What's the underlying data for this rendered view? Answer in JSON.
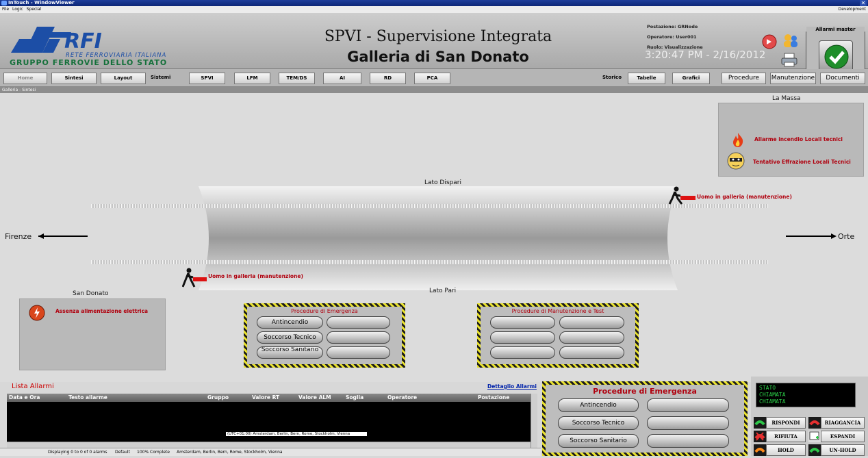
{
  "window": {
    "title": "InTouch - WindowViewer",
    "menus": [
      "File",
      "Logic",
      "Special"
    ],
    "right_label": "Development"
  },
  "header": {
    "brand_main": "RFI",
    "brand_sub": "RETE FERROVIARIA ITALIANA",
    "brand_group": "GRUPPO FERROVIE DELLO STATO",
    "title": "SPVI - Supervisione Integrata",
    "subtitle": "Galleria di San Donato",
    "postazione": "Postazione: GRNode",
    "operatore": "Operatore: User001",
    "ruolo": "Ruolo: Visualizzazione",
    "clock": "3:20:47 PM - 2/16/2012",
    "alarm_master_label": "Allarmi master"
  },
  "nav": {
    "home": "Home",
    "sintesi": "Sintesi",
    "layout": "Layout",
    "sistemi_label": "Sistemi",
    "sistemi": [
      "SPVI",
      "LFM",
      "TEM/DS",
      "AI",
      "RD",
      "PCA"
    ],
    "storico_label": "Storico",
    "tabelle": "Tabelle",
    "grafici": "Grafici",
    "procedure": "Procedure",
    "manutenzione": "Manutenzione",
    "documenti": "Documenti"
  },
  "breadcrumb": "Galleria - Sintesi",
  "tunnel": {
    "la_massa": "La Massa",
    "alarm_incendio": "Allarme incendio Locali tecnici",
    "tentativo_effrazione": "Tentativo Effrazione Locali Tecnici",
    "lato_dispari": "Lato Dispari",
    "lato_pari": "Lato Pari",
    "firenze": "Firenze",
    "orte": "Orte",
    "uomo_top": "Uomo in galleria (manutenzione)",
    "uomo_bottom": "Uomo in galleria (manutenzione)",
    "san_donato": "San Donato",
    "assenza": "Assenza alimentazione elettrica"
  },
  "proc_emergenza": {
    "title": "Procedure di Emergenza",
    "buttons": [
      "Antincendio",
      "Soccorso Tecnico",
      "Soccorso Sanitario"
    ]
  },
  "proc_manutenzione": {
    "title": "Procedure di Manutenzione e Test"
  },
  "alarms": {
    "title": "Lista Allarmi",
    "detail_link": "Dettaglio Allarmi",
    "columns": [
      "Data e Ora",
      "Testo allarme",
      "Gruppo",
      "Valore RT",
      "Valore ALM",
      "Soglia",
      "Operatore",
      "Postazione"
    ],
    "timezone": "(UTC+01:00) Amsterdam, Berlin, Bern, Rome, Stockholm, Vienna",
    "status": [
      "Displaying 0 to 0 of 0 alarms",
      "Default",
      "100% Complete",
      "Amsterdam, Berlin, Bern, Rome, Stockholm, Vienna"
    ]
  },
  "proc_emergenza2": {
    "title": "Procedure di Emergenza",
    "buttons": [
      "Antincendio",
      "Soccorso Tecnico",
      "Soccorso Sanitario"
    ]
  },
  "phone": {
    "stato": [
      "STATO",
      "CHIAMATA",
      "CHIAMATA"
    ],
    "rispondi": "RISPONDI",
    "riaggancia": "RIAGGANCIA",
    "rifiuta": "RIFIUTA",
    "espandi": "ESPANDI",
    "hold": "HOLD",
    "unhold": "UN-HOLD"
  },
  "colors": {
    "alarm_red": "#b0000e",
    "hatch_yellow": "#e9e22e",
    "logo_blue": "#1c4ea6",
    "logo_green": "#14703a"
  }
}
